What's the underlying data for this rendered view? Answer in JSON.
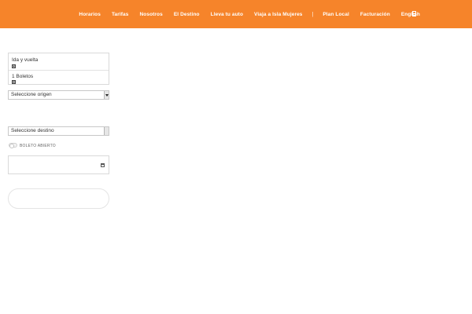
{
  "header": {
    "nav": [
      {
        "label": "Horarios"
      },
      {
        "label": "Tarifas"
      },
      {
        "label": "Nosotros"
      },
      {
        "label": "El Destino"
      },
      {
        "label": "Lleva tu auto"
      },
      {
        "label": "Viaja a Isla Mujeres"
      },
      {
        "label": "Plan Local"
      },
      {
        "label": "Facturación"
      },
      {
        "label": "English"
      }
    ],
    "separator": "|",
    "menu_icon": "menu-icon"
  },
  "booking": {
    "trip_type": "Ida y vuelta",
    "tickets": "1 Boletos",
    "origin_select": "Seleccione origen",
    "destination_select": "Seleccione destino",
    "open_ticket_label": "BOLETO ABIERTO",
    "date_value": "",
    "calendar_icon": "calendar-icon"
  },
  "colors": {
    "header_bg": "#f6842a",
    "nav_text": "#ffffff"
  }
}
